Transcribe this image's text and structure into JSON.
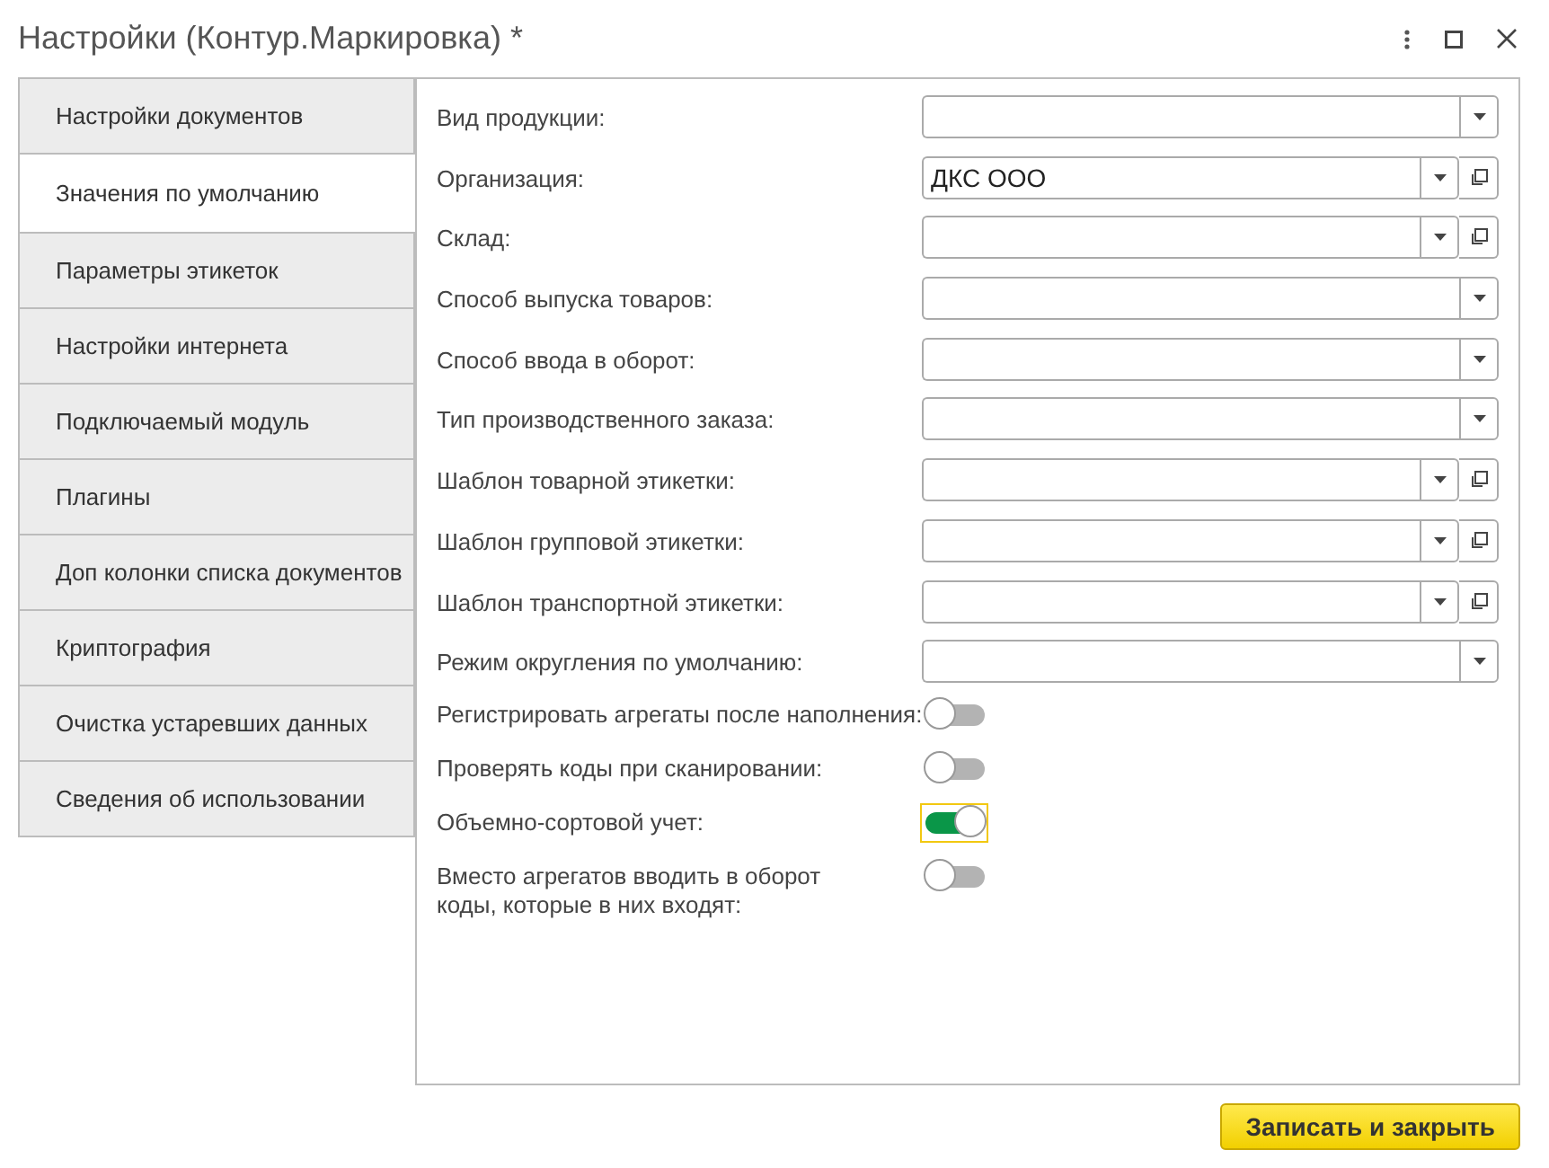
{
  "window": {
    "title": "Настройки (Контур.Маркировка) *"
  },
  "tabs": [
    {
      "label": "Настройки документов",
      "selected": false
    },
    {
      "label": "Значения по умолчанию",
      "selected": true
    },
    {
      "label": "Параметры этикеток",
      "selected": false
    },
    {
      "label": "Настройки интернета",
      "selected": false
    },
    {
      "label": "Подключаемый модуль",
      "selected": false
    },
    {
      "label": "Плагины",
      "selected": false
    },
    {
      "label": "Доп колонки списка документов",
      "selected": false
    },
    {
      "label": "Криптография",
      "selected": false
    },
    {
      "label": "Очистка устаревших данных",
      "selected": false
    },
    {
      "label": "Сведения об использовании",
      "selected": false
    }
  ],
  "fields": [
    {
      "kind": "select",
      "label": "Вид продукции:",
      "open_button": false
    },
    {
      "kind": "select",
      "label": "Организация:",
      "value": "ДКС ООО",
      "open_button": true
    },
    {
      "kind": "select",
      "label": "Склад:",
      "open_button": true
    },
    {
      "kind": "select",
      "label": "Способ выпуска товаров:",
      "open_button": false
    },
    {
      "kind": "select",
      "label": "Способ ввода в оборот:",
      "open_button": false
    },
    {
      "kind": "select",
      "label": "Тип производственного заказа:",
      "open_button": false
    },
    {
      "kind": "select",
      "label": "Шаблон товарной этикетки:",
      "open_button": true
    },
    {
      "kind": "select",
      "label": "Шаблон групповой этикетки:",
      "open_button": true
    },
    {
      "kind": "select",
      "label": "Шаблон транспортной этикетки:",
      "open_button": true
    },
    {
      "kind": "select",
      "label": "Режим округления по умолчанию:",
      "open_button": false
    },
    {
      "kind": "toggle",
      "label": "Регистрировать агрегаты после наполнения:",
      "on": false,
      "focused": false
    },
    {
      "kind": "toggle",
      "label": "Проверять коды при сканировании:",
      "on": false,
      "focused": false
    },
    {
      "kind": "toggle",
      "label": "Объемно-сортовой учет:",
      "on": true,
      "focused": true
    },
    {
      "kind": "toggle",
      "label": "Вместо агрегатов вводить в оборот\nкоды, которые в них входят:",
      "on": false,
      "focused": false
    }
  ],
  "buttons": [
    {
      "label": "Записать и закрыть"
    }
  ]
}
